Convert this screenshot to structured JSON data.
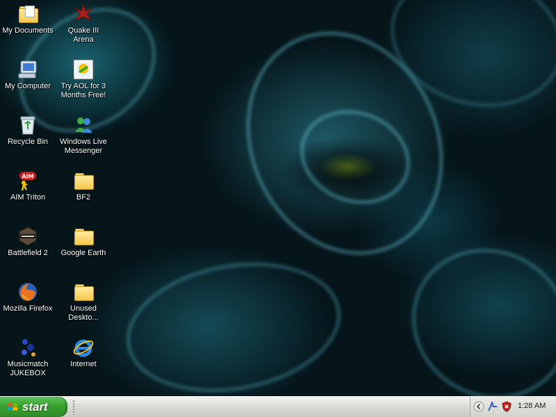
{
  "desktop": {
    "icons": [
      {
        "label": "My Documents",
        "icon": "my-documents-icon"
      },
      {
        "label": "Quake III Arena",
        "icon": "quake-icon"
      },
      {
        "label": "My Computer",
        "icon": "my-computer-icon"
      },
      {
        "label": "Try AOL for 3 Months Free!",
        "icon": "aol-icon"
      },
      {
        "label": "Recycle Bin",
        "icon": "recycle-bin-icon"
      },
      {
        "label": "Windows Live Messenger",
        "icon": "messenger-icon"
      },
      {
        "label": "AIM Triton",
        "icon": "aim-icon"
      },
      {
        "label": "BF2",
        "icon": "folder-icon"
      },
      {
        "label": "Battlefield 2",
        "icon": "battlefield-icon"
      },
      {
        "label": "Google Earth",
        "icon": "folder-icon"
      },
      {
        "label": "Mozilla Firefox",
        "icon": "firefox-icon"
      },
      {
        "label": "Unused Deskto...",
        "icon": "folder-icon"
      },
      {
        "label": "Musicmatch JUKEBOX",
        "icon": "musicmatch-icon"
      },
      {
        "label": "Internet",
        "icon": "internet-explorer-icon"
      }
    ],
    "wallpaper_colors": {
      "dark": "#05151a",
      "glow": "#3aa8ba",
      "eye": "#9bc03a"
    }
  },
  "taskbar": {
    "start_label": "start",
    "start_color": "#37a12f",
    "tray": {
      "icons": [
        "chevron-left-icon",
        "network-icon",
        "shield-icon"
      ],
      "clock": "1:28 AM"
    }
  }
}
